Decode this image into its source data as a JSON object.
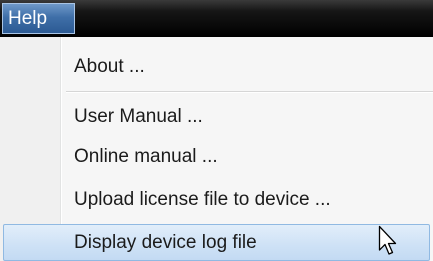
{
  "menubar": {
    "help_label": "Help"
  },
  "help_menu": {
    "items": [
      {
        "label": "About ..."
      },
      {
        "label": "User Manual ..."
      },
      {
        "label": "Online manual ..."
      },
      {
        "label": "Upload license file to device ..."
      },
      {
        "label": "Display device log file"
      }
    ],
    "highlighted_item": "Display device log file"
  },
  "colors": {
    "menubar_background": "#000000",
    "help_menu_highlight": "#3f6fa8",
    "item_hover_background": "#cfe2f6",
    "item_hover_border": "#90b9e2"
  },
  "icons": {
    "mouse_cursor": "arrow-pointer"
  }
}
